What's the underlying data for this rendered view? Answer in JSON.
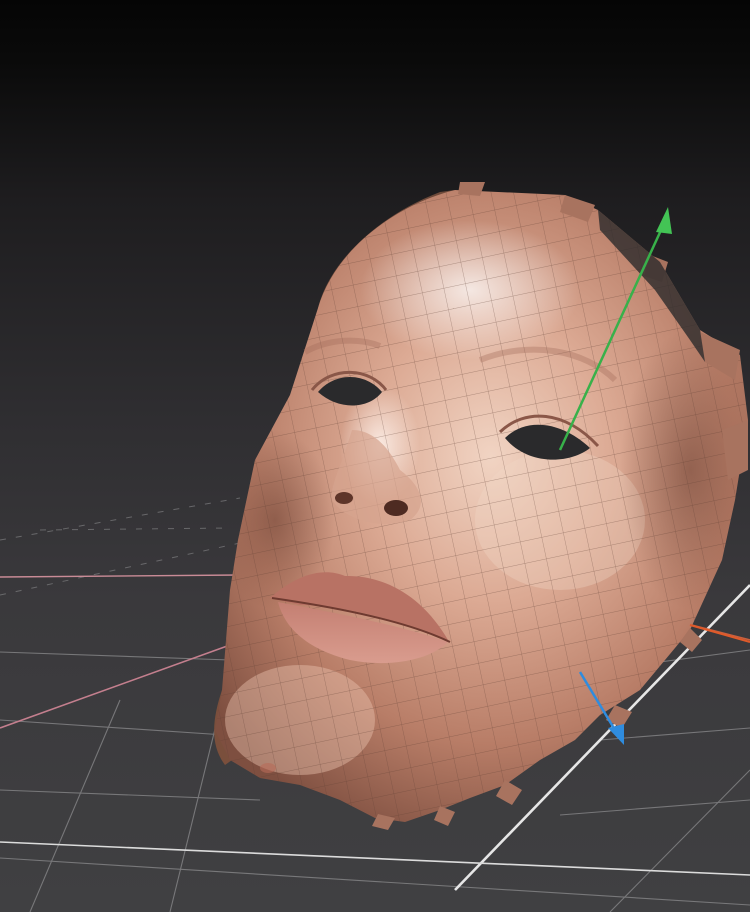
{
  "viewport": {
    "background_top": "#050505",
    "background_bottom": "#404042"
  },
  "scene": {
    "object": "face-scan-mesh",
    "grid_visible": true,
    "gizmo_visible": true
  },
  "colors": {
    "grid_line": "#8a8a8c",
    "grid_major": "#e4e4e4",
    "axis_x": "#d8665a",
    "axis_z": "#c88a9a",
    "gizmo_y": "#38b14a",
    "gizmo_z": "#2f8cde",
    "gizmo_x": "#e05a2a",
    "skin_light": "#e9c3b0",
    "skin_mid": "#c9927c",
    "skin_dark": "#8c5a48",
    "wire": "#5d3e33"
  }
}
